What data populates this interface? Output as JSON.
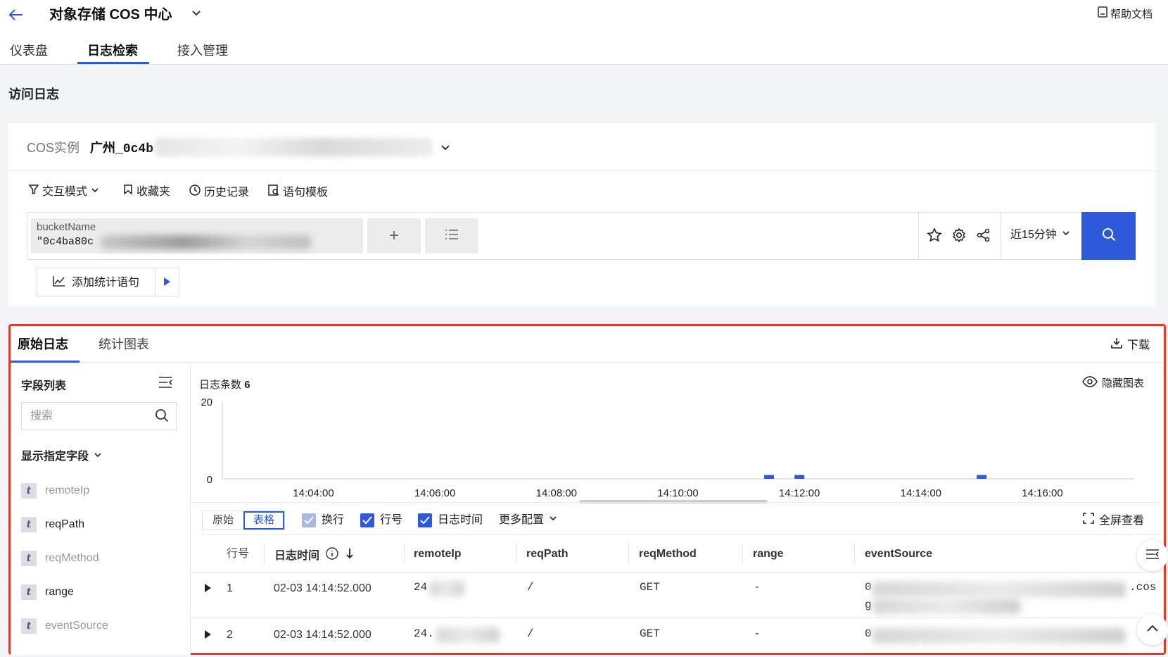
{
  "header": {
    "title": "对象存储 COS 中心",
    "help": "帮助文档"
  },
  "nav": {
    "tabs": [
      {
        "label": "仪表盘"
      },
      {
        "label": "日志检索"
      },
      {
        "label": "接入管理"
      }
    ],
    "active": "日志检索"
  },
  "section_title": "访问日志",
  "instance": {
    "label": "COS实例",
    "value": "广州_0c4b"
  },
  "toolbar": {
    "interactive_mode": "交互模式",
    "favorites": "收藏夹",
    "history": "历史记录",
    "templates": "语句模板"
  },
  "query": {
    "key": "bucketName",
    "value": "\"0c4ba80c",
    "add": "+",
    "time_range": "近15分钟"
  },
  "add_stat": {
    "label": "添加统计语句"
  },
  "results": {
    "tabs": [
      {
        "label": "原始日志"
      },
      {
        "label": "统计图表"
      }
    ],
    "download": "下载"
  },
  "sidebar": {
    "title": "字段列表",
    "search_placeholder": "搜索",
    "group": "显示指定字段",
    "fields": [
      {
        "type": "t",
        "name": "remoteIp",
        "muted": true
      },
      {
        "type": "t",
        "name": "reqPath",
        "muted": false
      },
      {
        "type": "t",
        "name": "reqMethod",
        "muted": true
      },
      {
        "type": "t",
        "name": "range",
        "muted": false
      },
      {
        "type": "t",
        "name": "eventSource",
        "muted": true
      }
    ]
  },
  "chart": {
    "count_label": "日志条数",
    "count": "6",
    "hide": "隐藏图表"
  },
  "chart_data": {
    "type": "bar",
    "x": [
      "14:11:30",
      "14:12:00",
      "14:15:00"
    ],
    "values": [
      1,
      1,
      1
    ],
    "xticks": [
      "14:04:00",
      "14:06:00",
      "14:08:00",
      "14:10:00",
      "14:12:00",
      "14:14:00",
      "14:16:00"
    ],
    "yticks": [
      "20",
      "0"
    ],
    "ylim": [
      0,
      20
    ],
    "xlim": [
      "14:02:30",
      "14:17:30"
    ],
    "color": "#2e5ad9"
  },
  "view": {
    "raw": "原始",
    "table": "表格",
    "wrap": "换行",
    "line_no": "行号",
    "log_time": "日志时间",
    "more": "更多配置",
    "fullscreen": "全屏查看"
  },
  "table": {
    "columns": [
      "行号",
      "日志时间",
      "remoteIp",
      "reqPath",
      "reqMethod",
      "range",
      "eventSource"
    ],
    "rows": [
      {
        "no": "1",
        "time": "02-03 14:14:52.000",
        "ip": "24",
        "path": "/",
        "method": "GET",
        "range": "-",
        "src_prefix": "0",
        "src_suffix": ".cos",
        "src_line2": "g"
      },
      {
        "no": "2",
        "time": "02-03 14:14:52.000",
        "ip": "24.",
        "path": "/",
        "method": "GET",
        "range": "-",
        "src_prefix": "0",
        "src_suffix": "",
        "src_line2": ""
      }
    ]
  },
  "colors": {
    "accent": "#2e5ad9",
    "highlight_border": "#e03a2a"
  }
}
